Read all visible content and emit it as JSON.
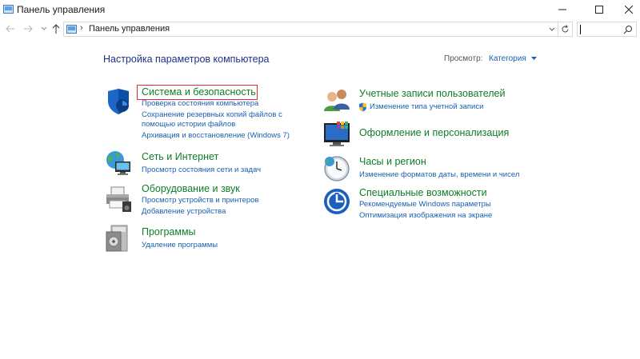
{
  "window": {
    "title": "Панель управления"
  },
  "address": {
    "path_label": "Панель управления"
  },
  "main": {
    "page_title": "Настройка параметров компьютера",
    "view_label": "Просмотр:",
    "view_value": "Категория"
  },
  "categories": {
    "security": {
      "title": "Система и безопасность",
      "links": [
        "Проверка состояния компьютера",
        "Сохранение резервных копий файлов с",
        "помощью истории файлов",
        "Архивация и восстановление (Windows 7)"
      ]
    },
    "network": {
      "title": "Сеть и Интернет",
      "links": [
        "Просмотр состояния сети и задач"
      ]
    },
    "hardware": {
      "title": "Оборудование и звук",
      "links": [
        "Просмотр устройств и принтеров",
        "Добавление устройства"
      ]
    },
    "programs": {
      "title": "Программы",
      "links": [
        "Удаление программы"
      ]
    },
    "accounts": {
      "title": "Учетные записи пользователей",
      "links": [
        "Изменение типа учетной записи"
      ]
    },
    "appearance": {
      "title": "Оформление и персонализация",
      "links": []
    },
    "clock": {
      "title": "Часы и регион",
      "links": [
        "Изменение форматов даты, времени и чисел"
      ]
    },
    "ease": {
      "title": "Специальные возможности",
      "links": [
        "Рекомендуемые Windows параметры",
        "Оптимизация изображения на экране"
      ]
    }
  },
  "colors": {
    "category_title": "#0e7d26",
    "link": "#1a5fb4",
    "page_title": "#1e3287",
    "highlight": "#d9302c"
  }
}
